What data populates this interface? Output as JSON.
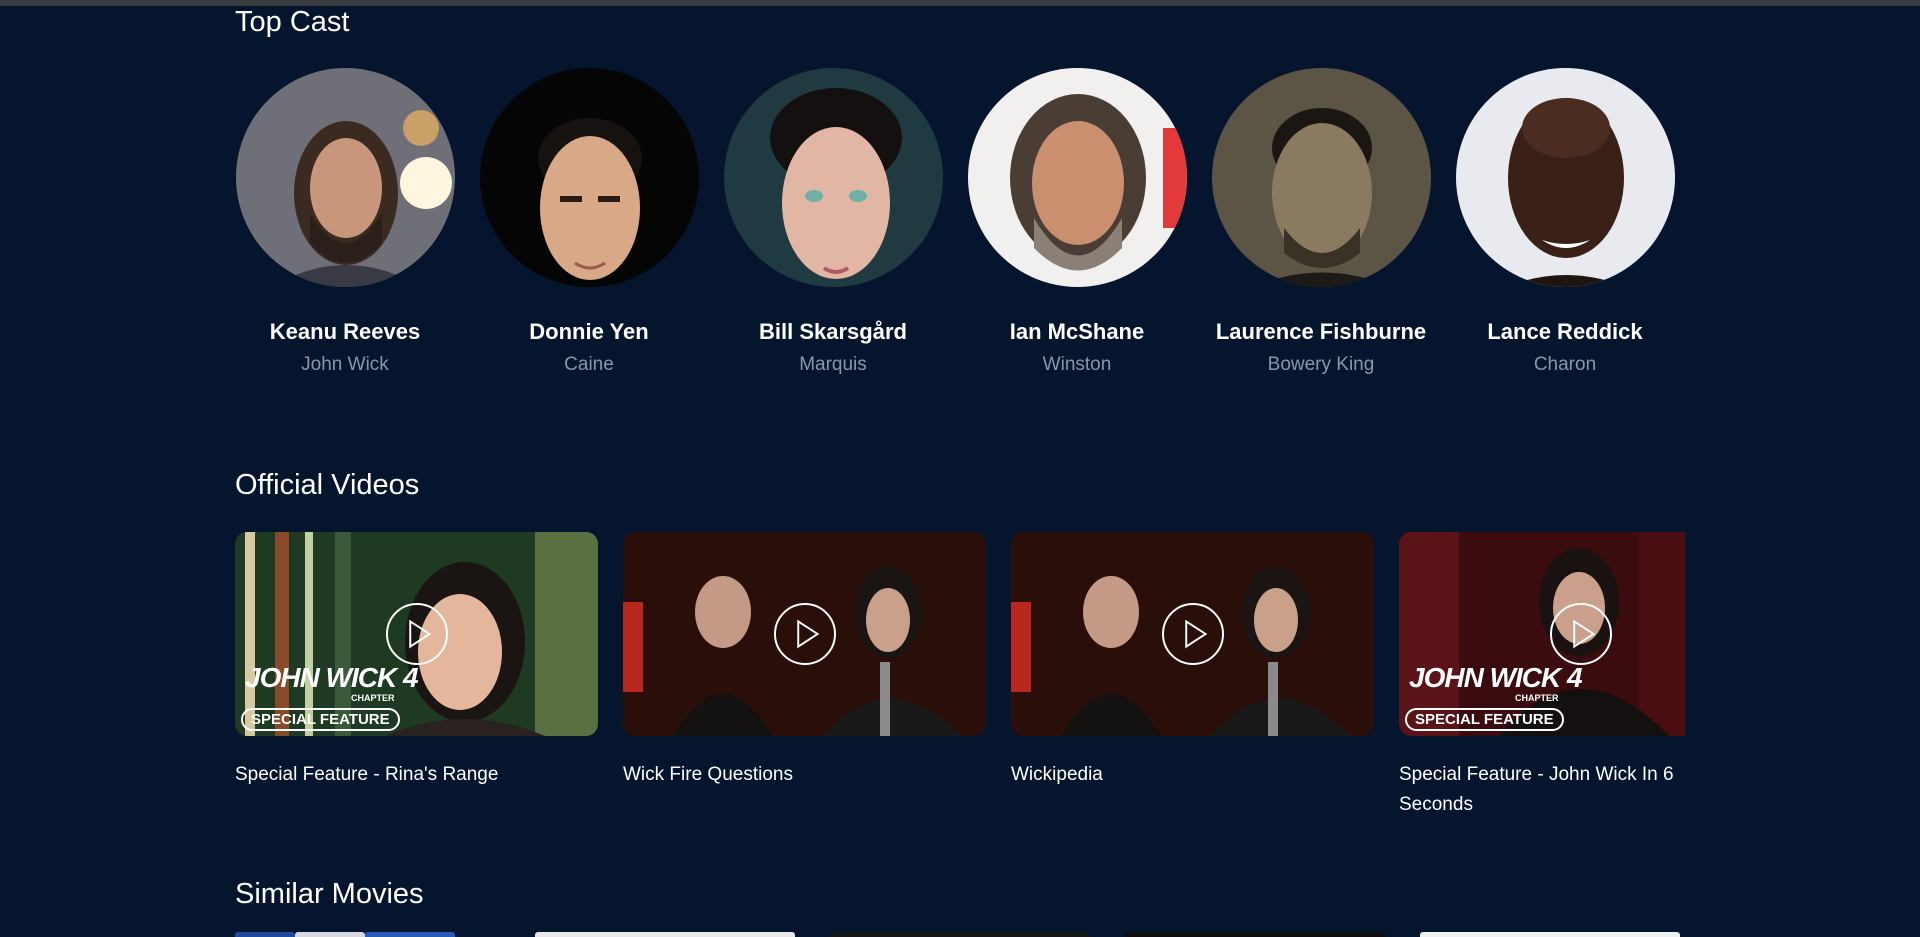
{
  "cast_section": {
    "title": "Top Cast",
    "members": [
      {
        "name": "Keanu Reeves",
        "role": "John Wick"
      },
      {
        "name": "Donnie Yen",
        "role": "Caine"
      },
      {
        "name": "Bill Skarsgård",
        "role": "Marquis"
      },
      {
        "name": "Ian McShane",
        "role": "Winston"
      },
      {
        "name": "Laurence Fishburne",
        "role": "Bowery King"
      },
      {
        "name": "Lance Reddick",
        "role": "Charon"
      }
    ]
  },
  "videos_section": {
    "title": "Official Videos",
    "videos": [
      {
        "title": "Special Feature - Rina's Range",
        "overlay_title": "JOHN WICK 4",
        "overlay_chapter": "CHAPTER",
        "overlay_badge": "SPECIAL FEATURE"
      },
      {
        "title": "Wick Fire Questions"
      },
      {
        "title": "Wickipedia"
      },
      {
        "title": "Special Feature - John Wick In 6 Seconds",
        "overlay_title": "JOHN WICK 4",
        "overlay_chapter": "CHAPTER",
        "overlay_badge": "SPECIAL FEATURE"
      }
    ]
  },
  "similar_section": {
    "title": "Similar Movies"
  },
  "colors": {
    "background": "#04152d",
    "text_primary": "#ffffff",
    "text_secondary": "#8a96a8"
  },
  "icons": {
    "play": "play-icon"
  }
}
